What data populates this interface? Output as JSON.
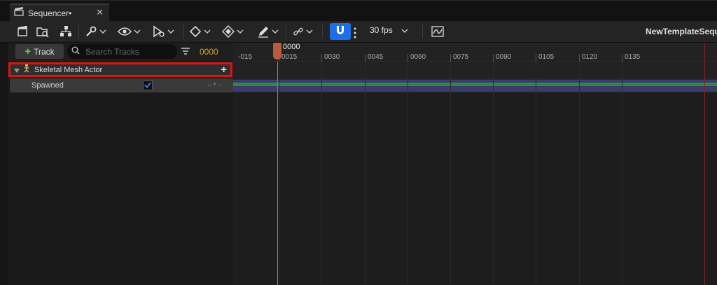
{
  "tab": {
    "title": "Sequencer•",
    "close": "✕"
  },
  "toolbar": {
    "fps_label": "30 fps",
    "sequence_name": "NewTemplateSeque"
  },
  "outliner": {
    "add_track_label": "Track",
    "search_placeholder": "Search Tracks",
    "current_frame": "0000",
    "actor_label": "Skeletal Mesh Actor",
    "spawned_label": "Spawned",
    "spawned_checked": true
  },
  "timeline": {
    "playhead_label": "0000",
    "ticks": [
      "-015",
      "0015",
      "0030",
      "0045",
      "0060",
      "0075",
      "0090",
      "0105",
      "0120",
      "0135"
    ]
  },
  "colors": {
    "accent_blue": "#1d6ee8",
    "highlight_red": "#e11212",
    "frame_orange": "#d7a21b",
    "track_green": "#2e8b3c",
    "spawn_purple": "#3b3b6e"
  }
}
